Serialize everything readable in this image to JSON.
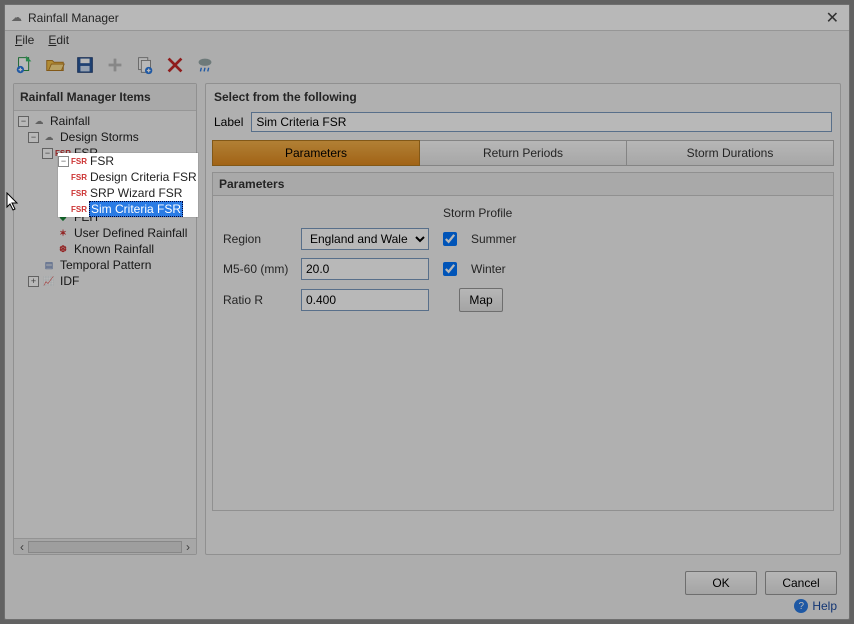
{
  "window": {
    "title": "Rainfall Manager"
  },
  "menubar": {
    "file": "File",
    "edit": "Edit"
  },
  "left": {
    "header": "Rainfall Manager Items",
    "tree": {
      "rainfall": "Rainfall",
      "design_storms": "Design Storms",
      "fsr": "FSR",
      "design_criteria_fsr": "Design Criteria FSR",
      "srp_wizard_fsr": "SRP Wizard FSR",
      "sim_criteria_fsr": "Sim Criteria FSR",
      "feh": "FEH",
      "user_defined_rainfall": "User Defined Rainfall",
      "known_rainfall": "Known Rainfall",
      "temporal_pattern": "Temporal Pattern",
      "idf": "IDF"
    }
  },
  "right": {
    "header": "Select from the following",
    "label_label": "Label",
    "label_value": "Sim Criteria FSR",
    "tabs": {
      "parameters": "Parameters",
      "return_periods": "Return Periods",
      "storm_durations": "Storm Durations"
    },
    "subheader": "Parameters",
    "params": {
      "region_label": "Region",
      "region_value": "England and Wales",
      "m560_label": "M5-60 (mm)",
      "m560_value": "20.0",
      "ratio_label": "Ratio R",
      "ratio_value": "0.400",
      "profile_label": "Storm Profile",
      "summer_label": "Summer",
      "winter_label": "Winter",
      "map_label": "Map"
    }
  },
  "footer": {
    "ok": "OK",
    "cancel": "Cancel",
    "help": "Help"
  },
  "colors": {
    "accent": "#e08a1f",
    "select": "#2a7be4"
  }
}
